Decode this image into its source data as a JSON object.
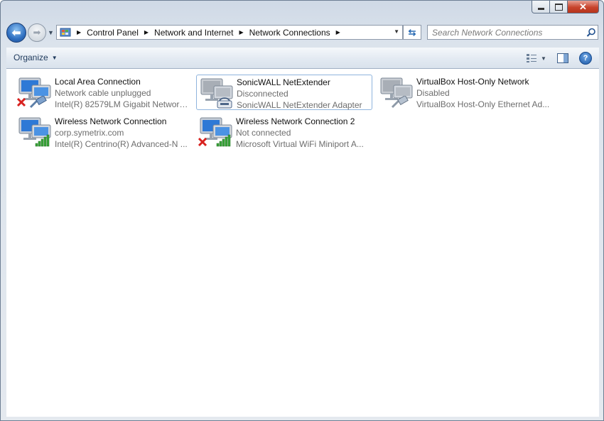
{
  "breadcrumb": [
    "Control Panel",
    "Network and Internet",
    "Network Connections"
  ],
  "search": {
    "placeholder": "Search Network Connections"
  },
  "toolbar": {
    "organize_label": "Organize"
  },
  "connections": [
    {
      "name": "Local Area Connection",
      "status": "Network cable unplugged",
      "adapter": "Intel(R) 82579LM Gigabit Network...",
      "badge": "cable-unplugged"
    },
    {
      "name": "SonicWALL NetExtender",
      "status": "Disconnected",
      "adapter": "SonicWALL NetExtender Adapter",
      "badge": "modem"
    },
    {
      "name": "VirtualBox Host-Only Network",
      "status": "Disabled",
      "adapter": "VirtualBox Host-Only Ethernet Ad...",
      "badge": "cable"
    },
    {
      "name": "Wireless Network Connection",
      "status": "corp.symetrix.com",
      "adapter": "Intel(R) Centrino(R) Advanced-N ...",
      "badge": "wifi-signal"
    },
    {
      "name": "Wireless Network Connection 2",
      "status": "Not connected",
      "adapter": "Microsoft Virtual WiFi Miniport A...",
      "badge": "wifi-disconnected"
    }
  ],
  "colors": {
    "window_frame": "#dbe3ec",
    "toolbar": "#e3eaf2",
    "selection_border": "#8fb4dd",
    "accent_blue": "#1e395b"
  }
}
